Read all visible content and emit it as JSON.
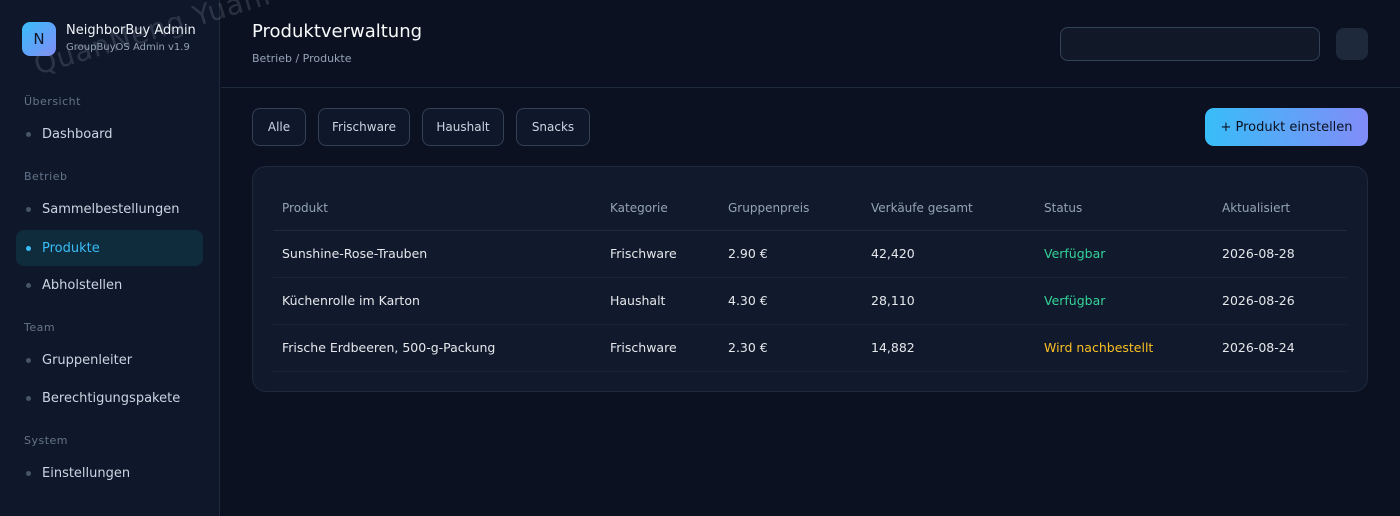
{
  "brand": {
    "logo_letter": "N",
    "title": "NeighborBuy Admin",
    "subtitle": "GroupBuyOS Admin v1.9"
  },
  "sidebar": {
    "sections": [
      "Übersicht",
      "Betrieb",
      "Team",
      "System"
    ],
    "items": [
      {
        "label": "Dashboard",
        "active": false
      },
      {
        "label": "Sammelbestellungen",
        "active": false
      },
      {
        "label": "Produkte",
        "active": true
      },
      {
        "label": "Abholstellen",
        "active": false
      },
      {
        "label": "Gruppenleiter",
        "active": false
      },
      {
        "label": "Berechtigungspakete",
        "active": false
      },
      {
        "label": "Einstellungen",
        "active": false
      }
    ]
  },
  "header": {
    "title": "Produktverwaltung",
    "breadcrumb": "Betrieb / Produkte",
    "search_value": "",
    "search_placeholder": ""
  },
  "filters": [
    "Alle",
    "Frischware",
    "Haushalt",
    "Snacks"
  ],
  "add_button_label": "+ Produkt einstellen",
  "table": {
    "columns": [
      "Produkt",
      "Kategorie",
      "Gruppenpreis",
      "Verkäufe gesamt",
      "Status",
      "Aktualisiert"
    ],
    "rows": [
      {
        "product": "Sunshine-Rose-Trauben",
        "category": "Frischware",
        "price": "2.90 €",
        "sales": "42,420",
        "status": "Verfügbar",
        "updated": "2026-08-28"
      },
      {
        "product": "Küchenrolle im Karton",
        "category": "Haushalt",
        "price": "4.30 €",
        "sales": "28,110",
        "status": "Verfügbar",
        "updated": "2026-08-26"
      },
      {
        "product": "Frische Erdbeeren, 500-g-Packung",
        "category": "Frischware",
        "price": "2.30 €",
        "sales": "14,882",
        "status": "Wird nachbestellt",
        "updated": "2026-08-24"
      }
    ]
  },
  "colors": {
    "accent": "#38bdf8",
    "status_available": "#34d399",
    "status_reorder": "#fbbf24"
  },
  "watermark": "QuanNeng YuanMa · inzyxuashop.com"
}
